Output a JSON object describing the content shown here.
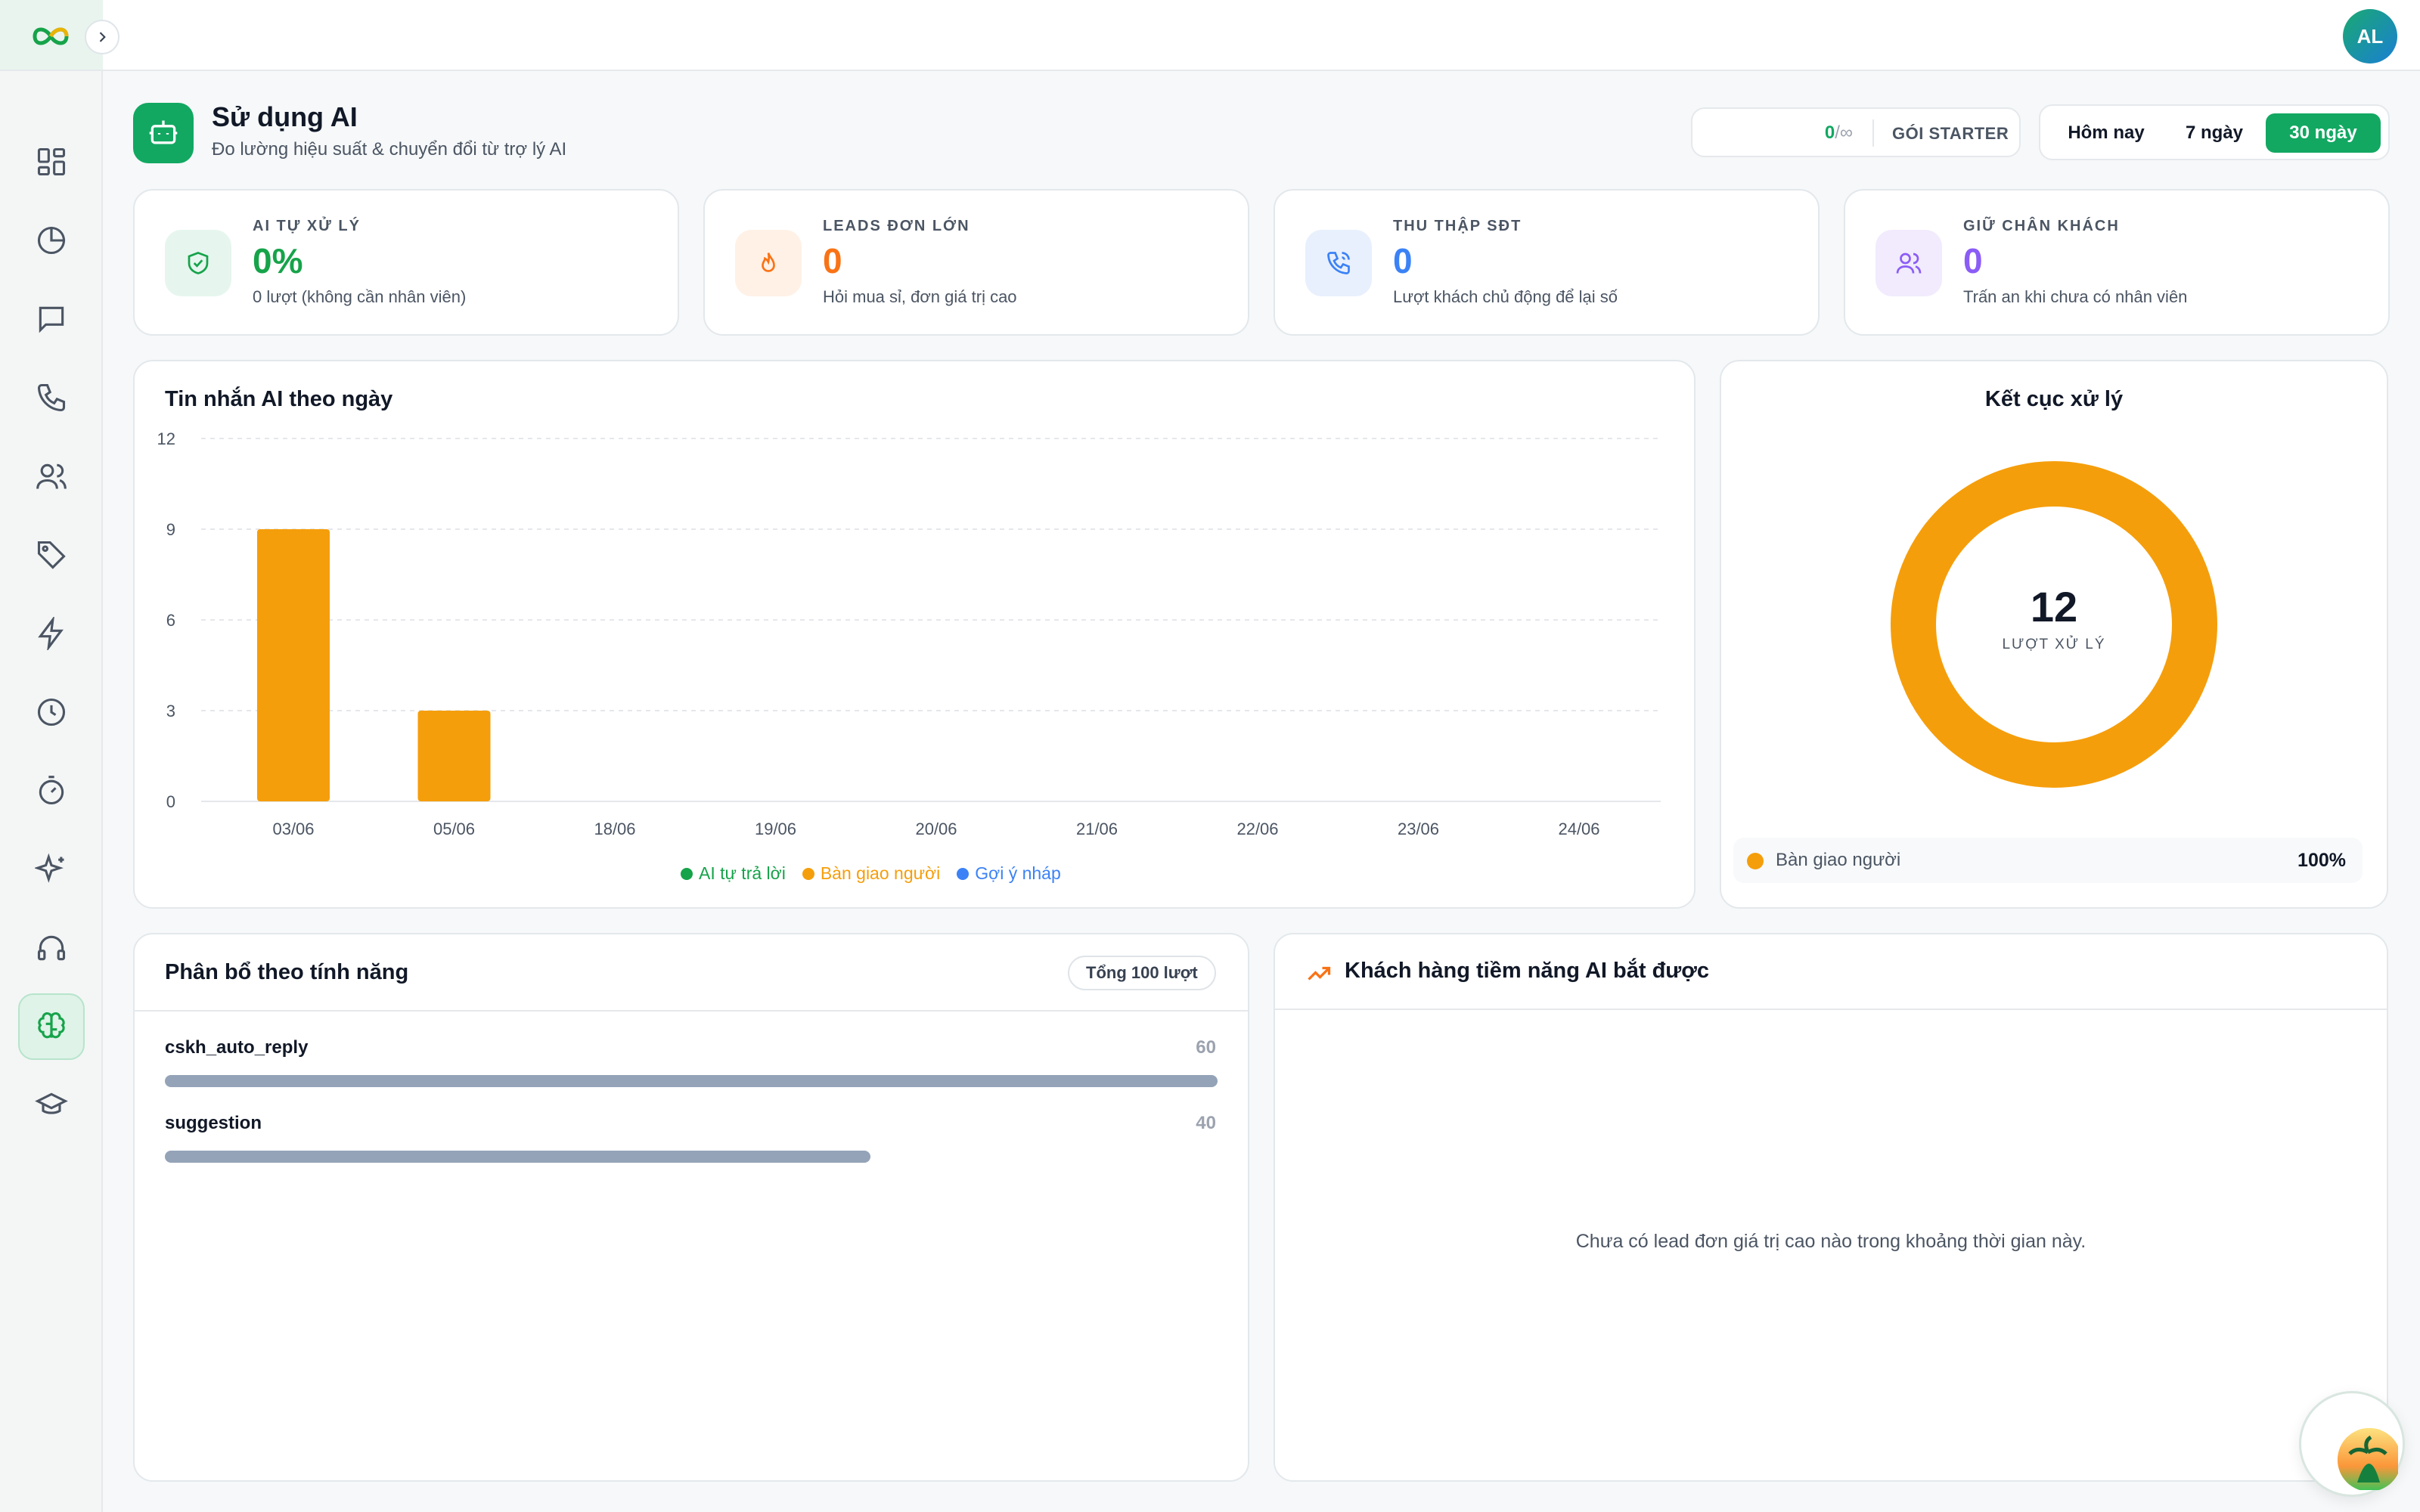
{
  "topbar": {
    "user_initials": "AL"
  },
  "header": {
    "title": "Sử dụng AI",
    "subtitle": "Đo lường hiệu suất & chuyển đổi từ trợ lý AI",
    "quota": {
      "used": "0",
      "limit": "/∞",
      "plan": "GÓI STARTER"
    },
    "ranges": [
      {
        "label": "Hôm nay",
        "active": false
      },
      {
        "label": "7 ngày",
        "active": false
      },
      {
        "label": "30 ngày",
        "active": true
      }
    ]
  },
  "stats": [
    {
      "label": "AI TỰ XỬ LÝ",
      "value": "0%",
      "desc": "0 lượt (không cần nhân viên)",
      "color": "#16a34a",
      "icon": "shield-check-icon"
    },
    {
      "label": "LEADS ĐƠN LỚN",
      "value": "0",
      "desc": "Hỏi mua sỉ, đơn giá trị cao",
      "color": "#f97316",
      "icon": "flame-icon"
    },
    {
      "label": "THU THẬP SĐT",
      "value": "0",
      "desc": "Lượt khách chủ động để lại số",
      "color": "#3b82f6",
      "icon": "phone-icon"
    },
    {
      "label": "GIỮ CHÂN KHÁCH",
      "value": "0",
      "desc": "Trấn an khi chưa có nhân viên",
      "color": "#8b5cf6",
      "icon": "users-icon"
    }
  ],
  "daily_chart": {
    "title": "Tin nhắn AI theo ngày",
    "legend": [
      {
        "name": "AI tự trả lời",
        "color": "#16a34a"
      },
      {
        "name": "Bàn giao người",
        "color": "#f59e0b"
      },
      {
        "name": "Gợi ý nháp",
        "color": "#3b82f6"
      }
    ]
  },
  "chart_data": {
    "type": "bar",
    "categories": [
      "03/06",
      "05/06",
      "18/06",
      "19/06",
      "20/06",
      "21/06",
      "22/06",
      "23/06",
      "24/06"
    ],
    "series": [
      {
        "name": "AI tự trả lời",
        "color": "#16a34a",
        "values": [
          0,
          0,
          0,
          0,
          0,
          0,
          0,
          0,
          0
        ]
      },
      {
        "name": "Bàn giao người",
        "color": "#f59e0b",
        "values": [
          9,
          3,
          0,
          0,
          0,
          0,
          0,
          0,
          0
        ]
      },
      {
        "name": "Gợi ý nháp",
        "color": "#3b82f6",
        "values": [
          0,
          0,
          0,
          0,
          0,
          0,
          0,
          0,
          0
        ]
      }
    ],
    "yticks": [
      0,
      3,
      6,
      9,
      12
    ],
    "ylim": [
      0,
      12
    ],
    "grid": true,
    "legend_position": "bottom"
  },
  "outcome": {
    "title": "Kết cục xử lý",
    "total": "12",
    "total_label": "LƯỢT XỬ LÝ",
    "items": [
      {
        "label": "Bàn giao người",
        "value": 12,
        "pct": "100%",
        "color": "#f59e0b"
      }
    ]
  },
  "features": {
    "title": "Phân bổ theo tính năng",
    "total_badge": "Tổng 100 lượt",
    "items": [
      {
        "name": "cskh_auto_reply",
        "count": "60",
        "fraction": 1.0
      },
      {
        "name": "suggestion",
        "count": "40",
        "fraction": 0.67
      }
    ]
  },
  "leads": {
    "title": "Khách hàng tiềm năng AI bắt được",
    "empty": "Chưa có lead đơn giá trị cao nào trong khoảng thời gian này."
  },
  "sidebar": {
    "items": [
      {
        "icon": "dashboard-icon",
        "active": false
      },
      {
        "icon": "pie-chart-icon",
        "active": false
      },
      {
        "icon": "chat-icon",
        "active": false
      },
      {
        "icon": "phone-icon",
        "active": false
      },
      {
        "icon": "users-icon",
        "active": false
      },
      {
        "icon": "tag-icon",
        "active": false
      },
      {
        "icon": "lightning-icon",
        "active": false
      },
      {
        "icon": "clock-icon",
        "active": false
      },
      {
        "icon": "timer-icon",
        "active": false
      },
      {
        "icon": "sparkles-icon",
        "active": false
      },
      {
        "icon": "headset-icon",
        "active": false
      },
      {
        "icon": "brain-icon",
        "active": true
      },
      {
        "icon": "graduation-cap-icon",
        "active": false
      }
    ]
  }
}
